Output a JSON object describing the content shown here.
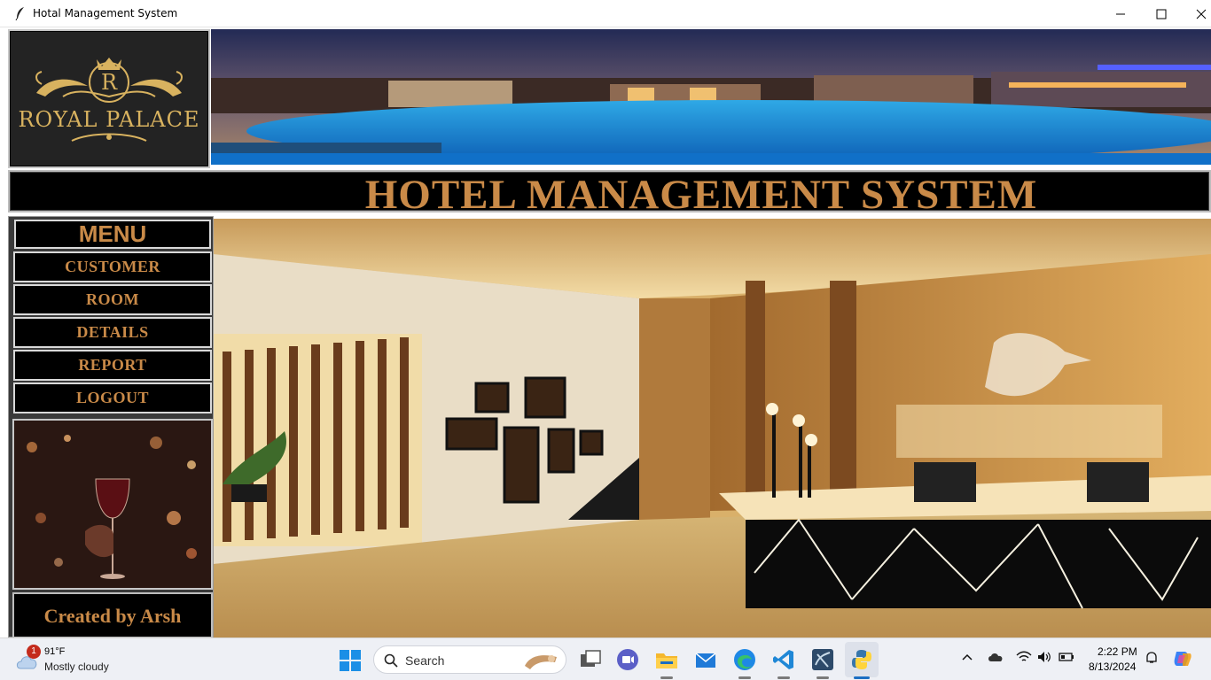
{
  "window": {
    "title": "Hotal Management System",
    "minimize_icon": "minimize-icon",
    "maximize_icon": "maximize-icon",
    "close_icon": "close-icon"
  },
  "logo": {
    "monogram": "R",
    "text": "ROYAL PALACE"
  },
  "header": {
    "title": "HOTEL MANAGEMENT SYSTEM"
  },
  "menu": {
    "title": "MENU",
    "items": [
      {
        "label": "CUSTOMER"
      },
      {
        "label": "ROOM"
      },
      {
        "label": "DETAILS"
      },
      {
        "label": "REPORT"
      },
      {
        "label": "LOGOUT"
      }
    ]
  },
  "footer": {
    "credit": "Created by Arsh"
  },
  "colors": {
    "accent_gold": "#c98a48",
    "panel_black": "#000000"
  },
  "taskbar": {
    "weather": {
      "badge": "1",
      "temp": "91°F",
      "condition": "Mostly cloudy"
    },
    "search_placeholder": "Search",
    "pinned_icons": [
      "task-view-icon",
      "meet-icon",
      "file-explorer-icon",
      "mail-icon",
      "edge-icon",
      "vscode-icon",
      "workbench-icon",
      "python-icon"
    ],
    "tray_icons": [
      "chevron-up-icon",
      "cloud-icon",
      "wifi-icon",
      "volume-icon",
      "battery-icon",
      "notification-icon",
      "copilot-icon"
    ],
    "clock": {
      "time": "2:22 PM",
      "date": "8/13/2024"
    }
  }
}
